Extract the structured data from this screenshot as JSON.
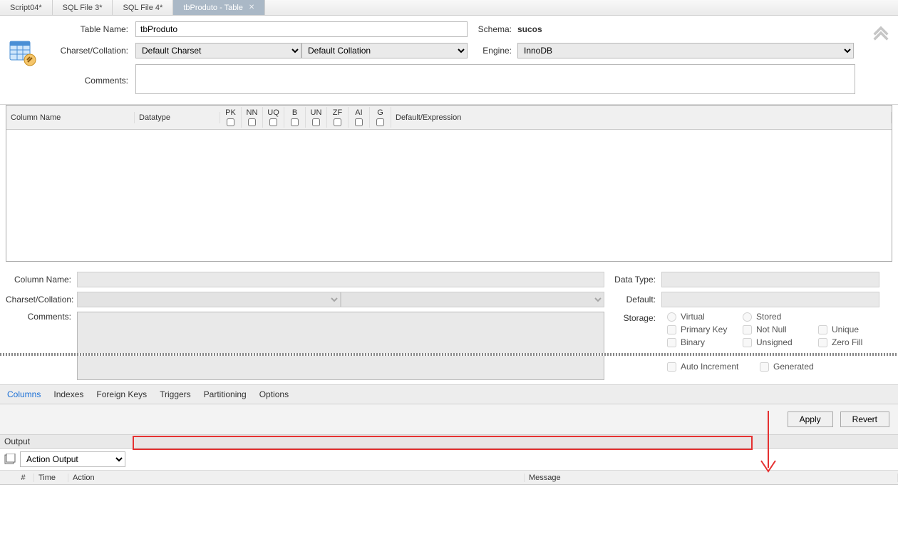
{
  "tabs": [
    {
      "label": "Script04*"
    },
    {
      "label": "SQL File 3*"
    },
    {
      "label": "SQL File 4*"
    },
    {
      "label": "tbProduto - Table",
      "active": true
    }
  ],
  "form": {
    "tableName_label": "Table Name:",
    "tableName_value": "tbProduto",
    "schema_label": "Schema:",
    "schema_value": "sucos",
    "charset_label": "Charset/Collation:",
    "charset_value": "Default Charset",
    "collation_value": "Default Collation",
    "engine_label": "Engine:",
    "engine_value": "InnoDB",
    "comments_label": "Comments:",
    "comments_value": ""
  },
  "grid": {
    "headers": {
      "name": "Column Name",
      "datatype": "Datatype",
      "pk": "PK",
      "nn": "NN",
      "uq": "UQ",
      "b": "B",
      "un": "UN",
      "zf": "ZF",
      "ai": "AI",
      "g": "G",
      "default": "Default/Expression"
    }
  },
  "details": {
    "columnName_label": "Column Name:",
    "datatype_label": "Data Type:",
    "charset_label": "Charset/Collation:",
    "default_label": "Default:",
    "comments_label": "Comments:",
    "storage_label": "Storage:",
    "virtual": "Virtual",
    "stored": "Stored",
    "primaryKey": "Primary Key",
    "notNull": "Not Null",
    "unique": "Unique",
    "binary": "Binary",
    "unsigned": "Unsigned",
    "zeroFill": "Zero Fill",
    "autoInc": "Auto Increment",
    "generated": "Generated"
  },
  "subtabs": {
    "columns": "Columns",
    "indexes": "Indexes",
    "fk": "Foreign Keys",
    "triggers": "Triggers",
    "partitioning": "Partitioning",
    "options": "Options"
  },
  "buttons": {
    "apply": "Apply",
    "revert": "Revert"
  },
  "output": {
    "panel_title": "Output",
    "selector": "Action Output",
    "cols": {
      "num": "#",
      "time": "Time",
      "action": "Action",
      "message": "Message"
    }
  }
}
